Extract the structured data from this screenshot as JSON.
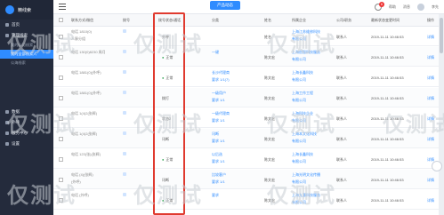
{
  "brand": {
    "name": "精线索"
  },
  "sidebar": {
    "items": [
      {
        "label": "首页",
        "kind": "section"
      },
      {
        "label": "管理线索",
        "kind": "section"
      },
      {
        "label": "我的公司线索",
        "kind": "sub"
      },
      {
        "label": "我的全部线索人",
        "kind": "sub",
        "active": true
      },
      {
        "label": "公海线索",
        "kind": "sub"
      },
      {
        "label": "数据",
        "kind": "section"
      },
      {
        "label": "外呼",
        "kind": "section"
      },
      {
        "label": "服务中心",
        "kind": "section"
      },
      {
        "label": "设置",
        "kind": "section"
      }
    ]
  },
  "topbar": {
    "center_tab": "产品动态",
    "badge_count": "6",
    "help": "帮助",
    "message": "消息",
    "user": "李先"
  },
  "table": {
    "headers": [
      "联系方式/微信",
      "拨号",
      "拨号状态/通话",
      "",
      "分类",
      "",
      "姓名",
      "所属企业",
      "公司/职务",
      "最新状态变更时间",
      "操作"
    ],
    "rows": [
      {
        "phone": "电话 1810(0)",
        "phone2": "人脉分组",
        "status": "外呼",
        "ok": false,
        "type": "",
        "type2": "",
        "name": "姓名",
        "company": "上海江苏维修科技",
        "company2": "有限公司",
        "contact": "联系人",
        "time": "2019-11-11 10:46:53",
        "op": "详情"
      },
      {
        "phone": "电话 130(0)8230 周月",
        "phone2": "",
        "status": "正常",
        "ok": true,
        "type": "一键",
        "type2": "",
        "name": "陈文宏",
        "company": "上海创智科技服务",
        "company2": "有限公司",
        "contact": "联系人",
        "time": "2019-11-11 10:46:53",
        "op": "详情"
      },
      {
        "phone": "电话 1881(0)(外呼)",
        "phone2": "",
        "status": "正常",
        "ok": true,
        "type": "长沙代理商",
        "type2": "要求 1/1(7)",
        "name": "陈文宏",
        "company": "上海长鑫科技",
        "company2": "有限公司",
        "contact": "联系人",
        "time": "2019-11-11 10:46:53",
        "op": "详情"
      },
      {
        "phone": "电话 1881(0)(外呼)",
        "phone2": "",
        "status": "拨打",
        "ok": false,
        "type": "一级用户",
        "type2": "要求 1/1",
        "name": "陈文宏",
        "company": "上海工作工程",
        "company2": "有限公司",
        "contact": "联系人",
        "time": "2019-11-11 10:46:53",
        "op": "详情"
      },
      {
        "phone": "电话 1(4)2(张辉)",
        "phone2": "",
        "status": "状态2",
        "ok": false,
        "type": "一级代理商",
        "type2": "要求 1/1",
        "name": "陈文宏",
        "company": "上海科技企业",
        "company2": "有限公司",
        "contact": "联系人",
        "time": "2019-11-11 10:46:53",
        "op": "详情"
      },
      {
        "phone": "电话 1(4)2(张辉)",
        "phone2": "",
        "status": "讯断",
        "ok": false,
        "type": "讯断",
        "type2": "要求 1/1",
        "name": "陈文宏",
        "company": "上海本文化科技",
        "company2": "有限公司",
        "contact": "联系人",
        "time": "2019-11-11 10:46:53",
        "op": "详情"
      },
      {
        "phone": "电话 123(张)(张辉)",
        "phone2": "",
        "status": "正常",
        "ok": true,
        "type": "以后选",
        "type2": "要求 1/1",
        "name": "陈文宏",
        "company": "上海长鑫科技",
        "company2": "有限公司",
        "contact": "联系人",
        "time": "2019-11-11 10:46:53",
        "op": "详情"
      },
      {
        "phone": "电话 (4)(张辉)",
        "phone2": "(外呼)",
        "status": "讯断",
        "ok": false,
        "type": "比较客户",
        "type2": "要求 1/1",
        "name": "陈文宏",
        "company": "上海光明文化传播",
        "company2": "有限公司",
        "contact": "联系人",
        "time": "2019-11-11 10:46:53",
        "op": "详情"
      },
      {
        "phone": "电话 (外呼)",
        "phone2": "",
        "status": "正常",
        "ok": true,
        "type": "要求",
        "type2": "",
        "name": "陈文宏",
        "company": "上海九惠科技服务",
        "company2": "有限公司",
        "contact": "联系人",
        "time": "2019-11-11 10:46:53",
        "op": "详情"
      }
    ]
  },
  "watermark": {
    "text": "仅测试"
  }
}
